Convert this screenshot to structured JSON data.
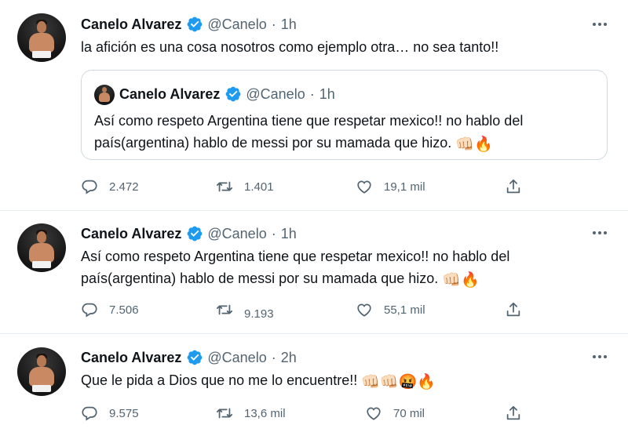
{
  "colors": {
    "verified": "#1d9bf0",
    "secondary_text": "#536471",
    "divider": "#e6ecf0"
  },
  "tweets": [
    {
      "author": {
        "name": "Canelo Alvarez",
        "handle": "@Canelo",
        "time": "1h"
      },
      "text": "la afición es una cosa nosotros como ejemplo otra… no sea tanto!!",
      "quoted": {
        "author": {
          "name": "Canelo Alvarez",
          "handle": "@Canelo",
          "time": "1h"
        },
        "text": "Así como respeto Argentina tiene que respetar mexico!! no hablo del país(argentina) hablo de messi por su mamada que hizo.",
        "emojis": [
          "👊🏻",
          "🔥"
        ]
      },
      "stats": {
        "replies": "2.472",
        "retweets": "1.401",
        "likes": "19,1 mil"
      }
    },
    {
      "author": {
        "name": "Canelo Alvarez",
        "handle": "@Canelo",
        "time": "1h"
      },
      "text": "Así como respeto Argentina tiene que respetar mexico!! no hablo del país(argentina) hablo de messi por su mamada que hizo.",
      "emojis": [
        "👊🏻",
        "🔥"
      ],
      "stats": {
        "replies": "7.506",
        "retweets": "9.193",
        "likes": "55,1 mil"
      }
    },
    {
      "author": {
        "name": "Canelo Alvarez",
        "handle": "@Canelo",
        "time": "2h"
      },
      "text": "Que le pida a Dios que no me lo encuentre!!",
      "emojis": [
        "👊🏻",
        "👊🏻",
        "🤬",
        "🔥"
      ],
      "stats": {
        "replies": "9.575",
        "retweets": "13,6 mil",
        "likes": "70 mil"
      }
    }
  ],
  "icons": {
    "verified": "verified-badge-icon",
    "more": "more-options-icon",
    "reply": "reply-icon",
    "retweet": "retweet-icon",
    "like": "like-icon",
    "share": "share-icon"
  }
}
